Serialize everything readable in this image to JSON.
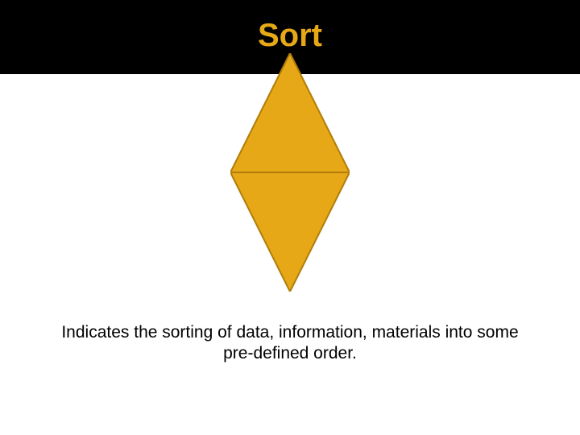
{
  "title": "Sort",
  "description": "Indicates the sorting of data, information, materials into some pre-defined order.",
  "colors": {
    "title_bar_bg": "#000000",
    "title_text": "#e6a817",
    "shape_fill": "#e6a817",
    "shape_stroke": "#b07d0a"
  },
  "shape": {
    "type": "diamond",
    "name": "sort-symbol"
  }
}
